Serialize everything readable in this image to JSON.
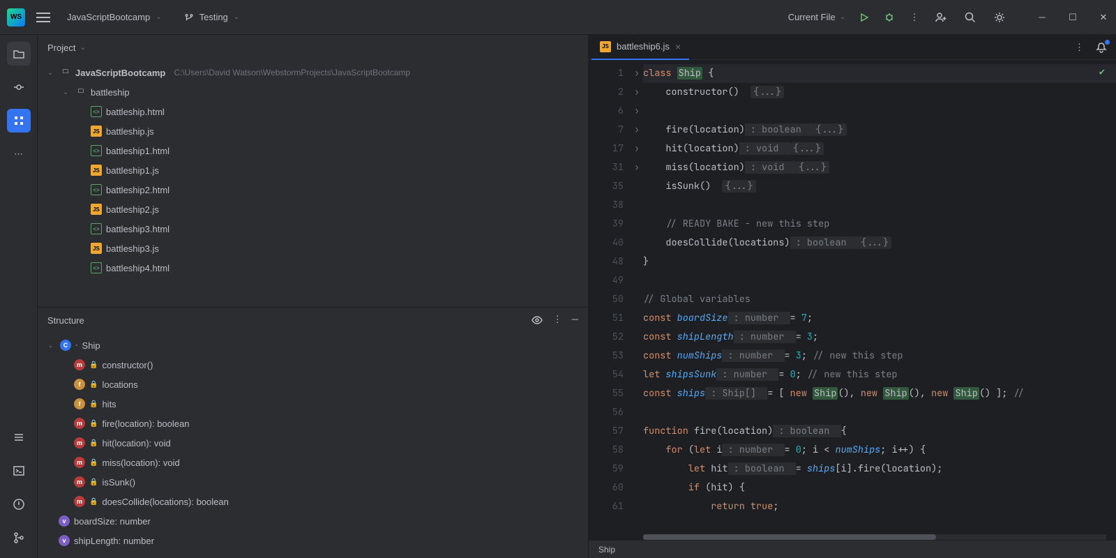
{
  "titlebar": {
    "project_name": "JavaScriptBootcamp",
    "branch_label": "Testing",
    "run_config": "Current File"
  },
  "project_panel": {
    "title": "Project",
    "root": "JavaScriptBootcamp",
    "root_path": "C:\\Users\\David Watson\\WebstormProjects\\JavaScriptBootcamp",
    "folder": "battleship",
    "files": [
      "battleship.html",
      "battleship.js",
      "battleship1.html",
      "battleship1.js",
      "battleship2.html",
      "battleship2.js",
      "battleship3.html",
      "battleship3.js",
      "battleship4.html"
    ]
  },
  "structure_panel": {
    "title": "Structure",
    "class_name": "Ship",
    "members": [
      {
        "k": "m",
        "label": "constructor()"
      },
      {
        "k": "f",
        "label": "locations"
      },
      {
        "k": "f",
        "label": "hits"
      },
      {
        "k": "m",
        "label": "fire(location): boolean"
      },
      {
        "k": "m",
        "label": "hit(location): void"
      },
      {
        "k": "m",
        "label": "miss(location): void"
      },
      {
        "k": "m",
        "label": "isSunk()"
      },
      {
        "k": "m",
        "label": "doesCollide(locations): boolean"
      }
    ],
    "globals": [
      {
        "k": "v",
        "label": "boardSize: number"
      },
      {
        "k": "v",
        "label": "shipLength: number"
      }
    ]
  },
  "editor": {
    "tab_name": "battleship6.js",
    "breadcrumb": "Ship",
    "line_numbers": [
      "1",
      "2",
      "6",
      "7",
      "17",
      "31",
      "35",
      "38",
      "39",
      "40",
      "48",
      "49",
      "50",
      "51",
      "52",
      "53",
      "54",
      "55",
      "56",
      "57",
      "58",
      "59",
      "60",
      "61"
    ],
    "code": {
      "l1_a": "class ",
      "l1_b": "Ship",
      "l1_c": " {",
      "l2_a": "    constructor",
      "l2_b": "()",
      "l2_fold": "{...}",
      "l7_a": "    fire",
      "l7_b": "(location)",
      "l7_hint": " : boolean  ",
      "l7_fold": "{...}",
      "l17_a": "    hit",
      "l17_b": "(location)",
      "l17_hint": " : void  ",
      "l17_fold": "{...}",
      "l31_a": "    miss",
      "l31_b": "(location)",
      "l31_hint": " : void  ",
      "l31_fold": "{...}",
      "l35_a": "    isSunk",
      "l35_b": "()",
      "l35_fold": "{...}",
      "l39": "    // READY BAKE - new this step",
      "l40_a": "    doesCollide",
      "l40_b": "(locations)",
      "l40_hint": " : boolean  ",
      "l40_fold": "{...}",
      "l48": "}",
      "l50": "// Global variables",
      "l51_a": "const ",
      "l51_b": "boardSize",
      "l51_hint": " : number  ",
      "l51_c": "= ",
      "l51_d": "7",
      "l51_e": ";",
      "l52_a": "const ",
      "l52_b": "shipLength",
      "l52_hint": " : number  ",
      "l52_c": "= ",
      "l52_d": "3",
      "l52_e": ";",
      "l53_a": "const ",
      "l53_b": "numShips",
      "l53_hint": " : number  ",
      "l53_c": "= ",
      "l53_d": "3",
      "l53_e": "; ",
      "l53_f": "// new this step",
      "l54_a": "let ",
      "l54_b": "shipsSunk",
      "l54_hint": " : number  ",
      "l54_c": "= ",
      "l54_d": "0",
      "l54_e": "; ",
      "l54_f": "// new this step",
      "l55_a": "const ",
      "l55_b": "ships",
      "l55_hint": " : Ship[]  ",
      "l55_c": "= [ ",
      "l55_d": "new ",
      "l55_e": "Ship",
      "l55_f": "(), ",
      "l55_g": "new ",
      "l55_h": "Ship",
      "l55_i": "(), ",
      "l55_j": "new ",
      "l55_k": "Ship",
      "l55_l": "() ]; ",
      "l55_m": "//",
      "l57_a": "function ",
      "l57_b": "fire",
      "l57_c": "(location)",
      "l57_hint": " : boolean  ",
      "l57_d": "{",
      "l58_a": "    for ",
      "l58_b": "(",
      "l58_c": "let ",
      "l58_d": "i",
      "l58_hint": " : number  ",
      "l58_e": "= ",
      "l58_f": "0",
      "l58_g": "; i < ",
      "l58_h": "numShips",
      "l58_i": "; i++) {",
      "l59_a": "        let ",
      "l59_b": "hit",
      "l59_hint": " : boolean  ",
      "l59_c": "= ",
      "l59_d": "ships",
      "l59_e": "[i].",
      "l59_f": "fire",
      "l59_g": "(location);",
      "l60_a": "        if ",
      "l60_b": "(hit) {",
      "l61_a": "            return ",
      "l61_b": "true",
      "l61_c": ";"
    }
  }
}
